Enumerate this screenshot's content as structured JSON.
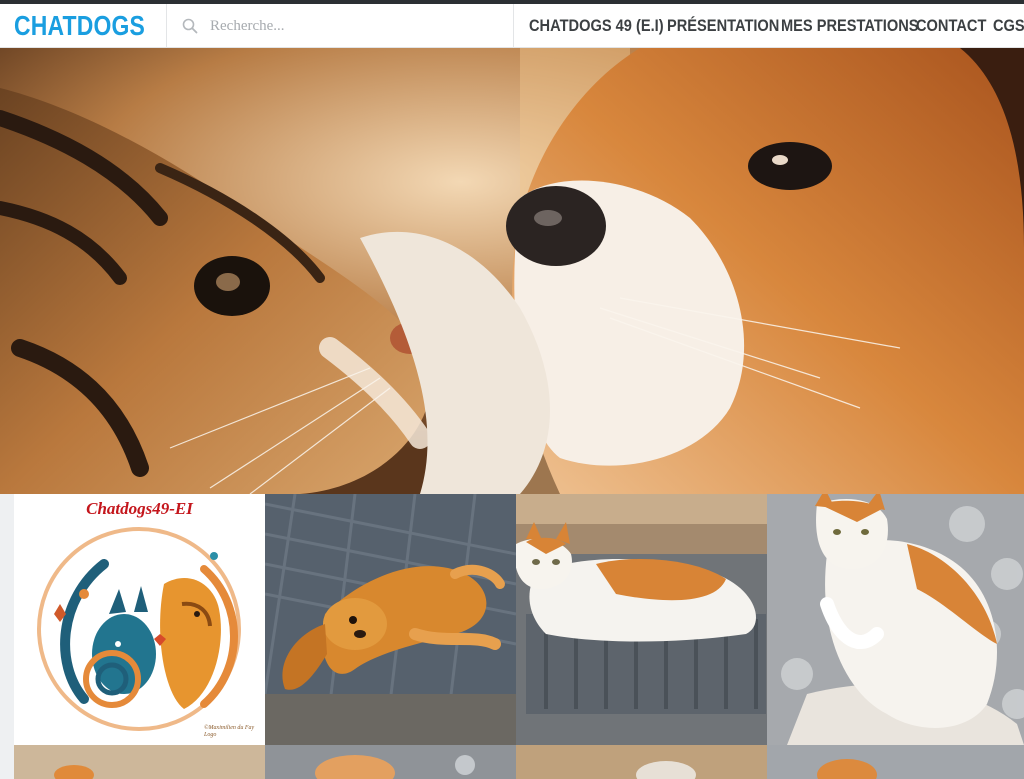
{
  "header": {
    "brand": "CHATDOGS",
    "search_placeholder": "Recherche...",
    "nav": [
      "CHATDOGS 49 (E.I)",
      "PRÉSENTATION",
      "MES PRESTATIONS",
      "CONTACT",
      "CGS"
    ]
  },
  "hero": {
    "alt": "kitten-and-puppy-photo"
  },
  "gallery": {
    "logo_title": "Chatdogs49-EI",
    "logo_credit_1": "©Maximilien du Fay",
    "logo_credit_2": "Logo"
  },
  "colors": {
    "brand": "#1a9ee0",
    "nav_text": "#3c4043",
    "logo_red": "#c4161c"
  }
}
